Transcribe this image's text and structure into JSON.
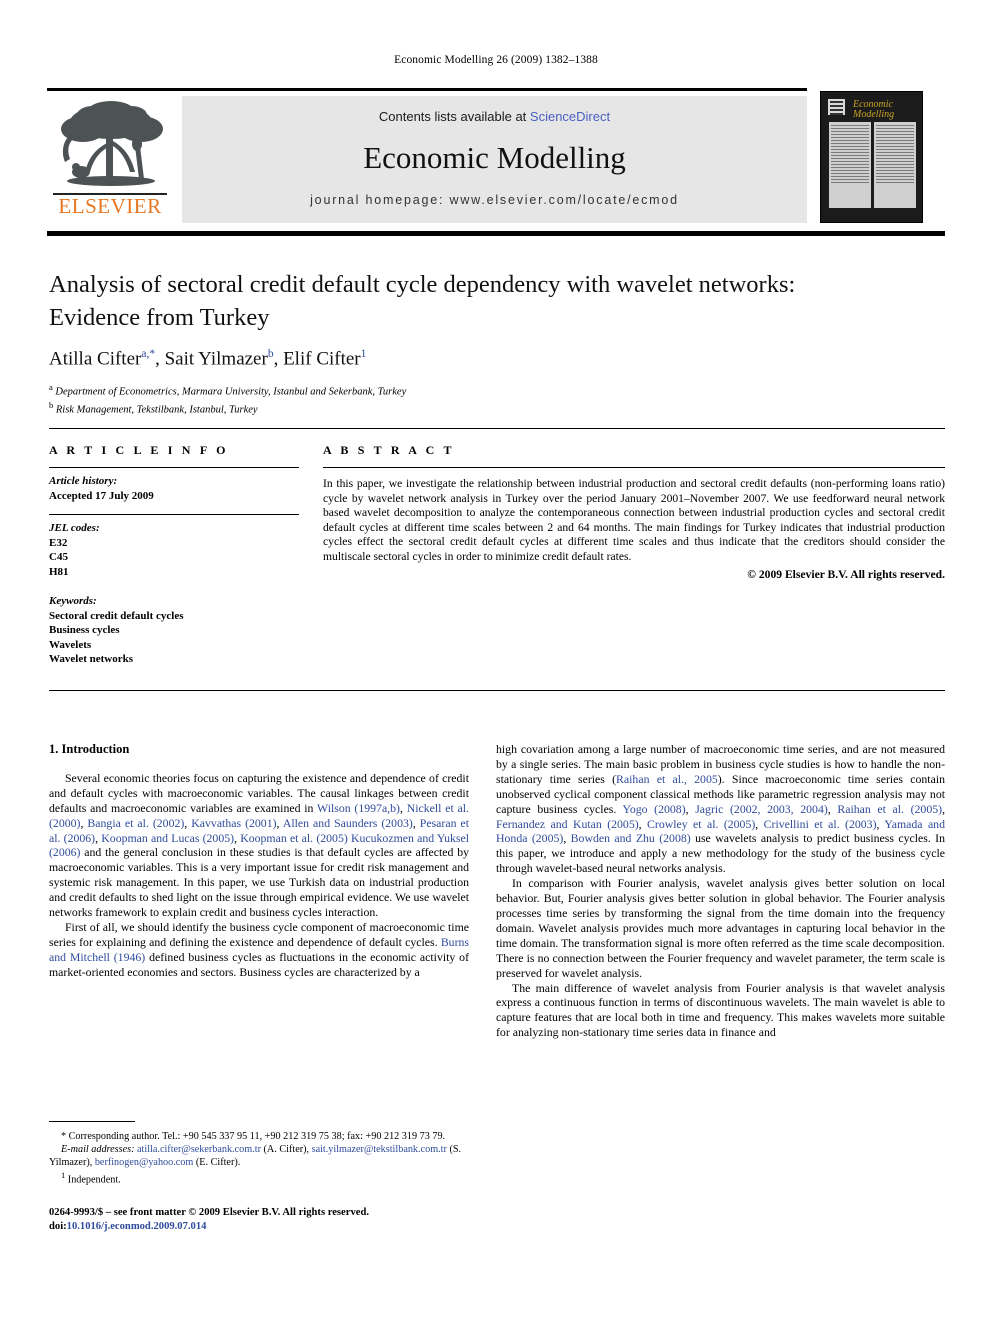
{
  "running_head": "Economic Modelling 26 (2009) 1382–1388",
  "masthead": {
    "publisher_name": "ELSEVIER",
    "contents_prefix": "Contents lists available at ",
    "contents_link": "ScienceDirect",
    "journal_title": "Economic Modelling",
    "homepage": "journal homepage: www.elsevier.com/locate/ecmod",
    "cover_title": "Economic Modelling"
  },
  "article": {
    "title": "Analysis of sectoral credit default cycle dependency with wavelet networks: Evidence from Turkey",
    "authors": "Atilla Cifter , Sait Yilmazer , Elif Cifter",
    "author_list": [
      {
        "name": "Atilla Cifter",
        "marks": "a,*"
      },
      {
        "name": "Sait Yilmazer",
        "marks": "b"
      },
      {
        "name": "Elif Cifter",
        "marks": "1"
      }
    ],
    "affiliations": [
      {
        "mark": "a",
        "text": "Department of Econometrics, Marmara University, Istanbul and Sekerbank, Turkey"
      },
      {
        "mark": "b",
        "text": "Risk Management, Tekstilbank, Istanbul, Turkey"
      }
    ]
  },
  "article_info": {
    "heading": "A R T I C L E    I N F O",
    "history_label": "Article history:",
    "history_value": "Accepted 17 July 2009",
    "jel_label": "JEL codes:",
    "jel_codes": [
      "E32",
      "C45",
      "H81"
    ],
    "keywords_label": "Keywords:",
    "keywords": [
      "Sectoral credit default cycles",
      "Business cycles",
      "Wavelets",
      "Wavelet networks"
    ]
  },
  "abstract": {
    "heading": "A B S T R A C T",
    "text": "In this paper, we investigate the relationship between industrial production and sectoral credit defaults (non-performing loans ratio) cycle by wavelet network analysis in Turkey over the period January 2001–November 2007. We use feedforward neural network based wavelet decomposition to analyze the contemporaneous connection between industrial production cycles and sectoral credit default cycles at different time scales between 2 and 64 months. The main findings for Turkey indicates that industrial production cycles effect the sectoral credit default cycles at different time scales and thus indicate that the creditors should consider the multiscale sectoral cycles in order to minimize credit default rates.",
    "copyright": "© 2009 Elsevier B.V. All rights reserved."
  },
  "body": {
    "section_heading": "1. Introduction",
    "left_paragraphs": [
      {
        "runs": [
          {
            "t": "Several economic theories focus on capturing the existence and dependence of credit and default cycles with macroeconomic variables. The causal linkages between credit defaults and macroeconomic variables are examined in "
          },
          {
            "t": "Wilson (1997a,b)",
            "cite": true
          },
          {
            "t": ", "
          },
          {
            "t": "Nickell et al. (2000)",
            "cite": true
          },
          {
            "t": ", "
          },
          {
            "t": "Bangia et al. (2002)",
            "cite": true
          },
          {
            "t": ", "
          },
          {
            "t": "Kavvathas (2001)",
            "cite": true
          },
          {
            "t": ", "
          },
          {
            "t": "Allen and Saunders (2003)",
            "cite": true
          },
          {
            "t": ", "
          },
          {
            "t": "Pesaran et al. (2006)",
            "cite": true
          },
          {
            "t": ", "
          },
          {
            "t": "Koopman and Lucas (2005)",
            "cite": true
          },
          {
            "t": ", "
          },
          {
            "t": "Koopman et al. (2005)",
            "cite": true
          },
          {
            "t": " "
          },
          {
            "t": "Kucukozmen and Yuksel (2006)",
            "cite": true
          },
          {
            "t": " and the general conclusion in these studies is that default cycles are affected by macroeconomic variables. This is a very important issue for credit risk management and systemic risk management. In this paper, we use Turkish data on industrial production and credit defaults to shed light on the issue through empirical evidence. We use wavelet networks framework to explain credit and business cycles interaction."
          }
        ]
      },
      {
        "runs": [
          {
            "t": "First of all, we should identify the business cycle component of macroeconomic time series for explaining and defining the existence and dependence of default cycles. "
          },
          {
            "t": "Burns and Mitchell (1946)",
            "cite": true
          },
          {
            "t": " defined business cycles as fluctuations in the economic activity of market-oriented economies and sectors. Business cycles are characterized by a"
          }
        ]
      }
    ],
    "right_paragraphs": [
      {
        "noindent": true,
        "runs": [
          {
            "t": "high covariation among a large number of macroeconomic time series, and are not measured by a single series. The main basic problem in business cycle studies is how to handle the non-stationary time series ("
          },
          {
            "t": "Raihan et al., 2005",
            "cite": true
          },
          {
            "t": "). Since macroeconomic time series contain unobserved cyclical component classical methods like parametric regression analysis may not capture business cycles. "
          },
          {
            "t": "Yogo (2008)",
            "cite": true
          },
          {
            "t": ", "
          },
          {
            "t": "Jagric (2002, 2003, 2004)",
            "cite": true
          },
          {
            "t": ", "
          },
          {
            "t": "Raihan et al. (2005)",
            "cite": true
          },
          {
            "t": ", "
          },
          {
            "t": "Fernandez and Kutan (2005)",
            "cite": true
          },
          {
            "t": ", "
          },
          {
            "t": "Crowley et al. (2005)",
            "cite": true
          },
          {
            "t": ", "
          },
          {
            "t": "Crivellini et al. (2003)",
            "cite": true
          },
          {
            "t": ", "
          },
          {
            "t": "Yamada and Honda (2005)",
            "cite": true
          },
          {
            "t": ", "
          },
          {
            "t": "Bowden and Zhu (2008)",
            "cite": true
          },
          {
            "t": " use wavelets analysis to predict business cycles. In this paper, we introduce and apply a new methodology for the study of the business cycle through wavelet-based neural networks analysis."
          }
        ]
      },
      {
        "runs": [
          {
            "t": "In comparison with Fourier analysis, wavelet analysis gives better solution on local behavior. But, Fourier analysis gives better solution in global behavior. The Fourier analysis processes time series by transforming the signal from the time domain into the frequency domain. Wavelet analysis provides much more advantages in capturing local behavior in the time domain. The transformation signal is more often referred as the time scale decomposition. There is no connection between the Fourier frequency and wavelet parameter, the term scale is preserved for wavelet analysis."
          }
        ]
      },
      {
        "runs": [
          {
            "t": "The main difference of wavelet analysis from Fourier analysis is that wavelet analysis express a continuous function in terms of discontinuous wavelets. The main wavelet is able to capture features that are local both in time and frequency. This makes wavelets more suitable for analyzing non-stationary time series data in finance and"
          }
        ]
      }
    ]
  },
  "footnotes": {
    "corresponding": "* Corresponding author. Tel.: +90 545 337 95 11, +90 212 319 75 38; fax: +90 212 319 73 79.",
    "email_label": "E-mail addresses:",
    "emails": [
      {
        "address": "atilla.cifter@sekerbank.com.tr",
        "owner": "(A. Cifter)"
      },
      {
        "address": "sait.yilmazer@tekstilbank.com.tr",
        "owner": "(S. Yilmazer)"
      },
      {
        "address": "berfinogen@yahoo.com",
        "owner": "(E. Cifter)"
      }
    ],
    "independent": "Independent.",
    "independent_mark": "1"
  },
  "imprint": {
    "front_matter": "0264-9993/$ – see front matter © 2009 Elsevier B.V. All rights reserved.",
    "doi_label": "doi:",
    "doi": "10.1016/j.econmod.2009.07.014"
  },
  "colors": {
    "citation_blue": "#2f4b9b",
    "link_blue": "#4a5fc1",
    "elsevier_orange": "#E87722",
    "banner_gray": "#e6e6e6",
    "cover_gold": "#c9a227"
  }
}
